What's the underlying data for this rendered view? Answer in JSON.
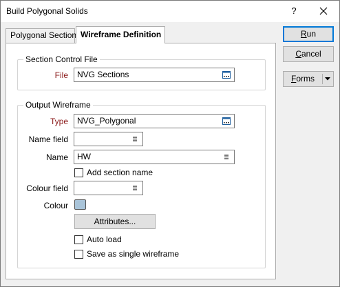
{
  "window": {
    "title": "Build Polygonal Solids",
    "help_label": "?"
  },
  "tabs": [
    {
      "label": "Polygonal Sections",
      "active": false
    },
    {
      "label": "Wireframe Definition",
      "active": true
    }
  ],
  "section_control": {
    "group_label": "Section Control File",
    "file_label": "File",
    "file_value": "NVG Sections"
  },
  "output_wireframe": {
    "group_label": "Output Wireframe",
    "type_label": "Type",
    "type_value": "NVG_Polygonal",
    "name_field_label": "Name field",
    "name_field_value": "",
    "name_label": "Name",
    "name_value": "HW",
    "add_section_name_label": "Add section name",
    "add_section_name_checked": false,
    "colour_field_label": "Colour field",
    "colour_field_value": "",
    "colour_label": "Colour",
    "colour_value": "#a9c4d9",
    "attributes_button": "Attributes...",
    "auto_load_label": "Auto load",
    "auto_load_checked": false,
    "single_wireframe_label": "Save as single wireframe",
    "single_wireframe_checked": false
  },
  "buttons": {
    "run_pre": "",
    "run_u": "R",
    "run_post": "un",
    "cancel_pre": "",
    "cancel_u": "C",
    "cancel_post": "ancel",
    "forms_pre": "",
    "forms_u": "F",
    "forms_post": "orms"
  },
  "icons": {
    "browse": "ellipsis-browse-icon",
    "list": "list-picker-icon",
    "close": "close-icon",
    "dropdown": "chevron-down-icon"
  }
}
